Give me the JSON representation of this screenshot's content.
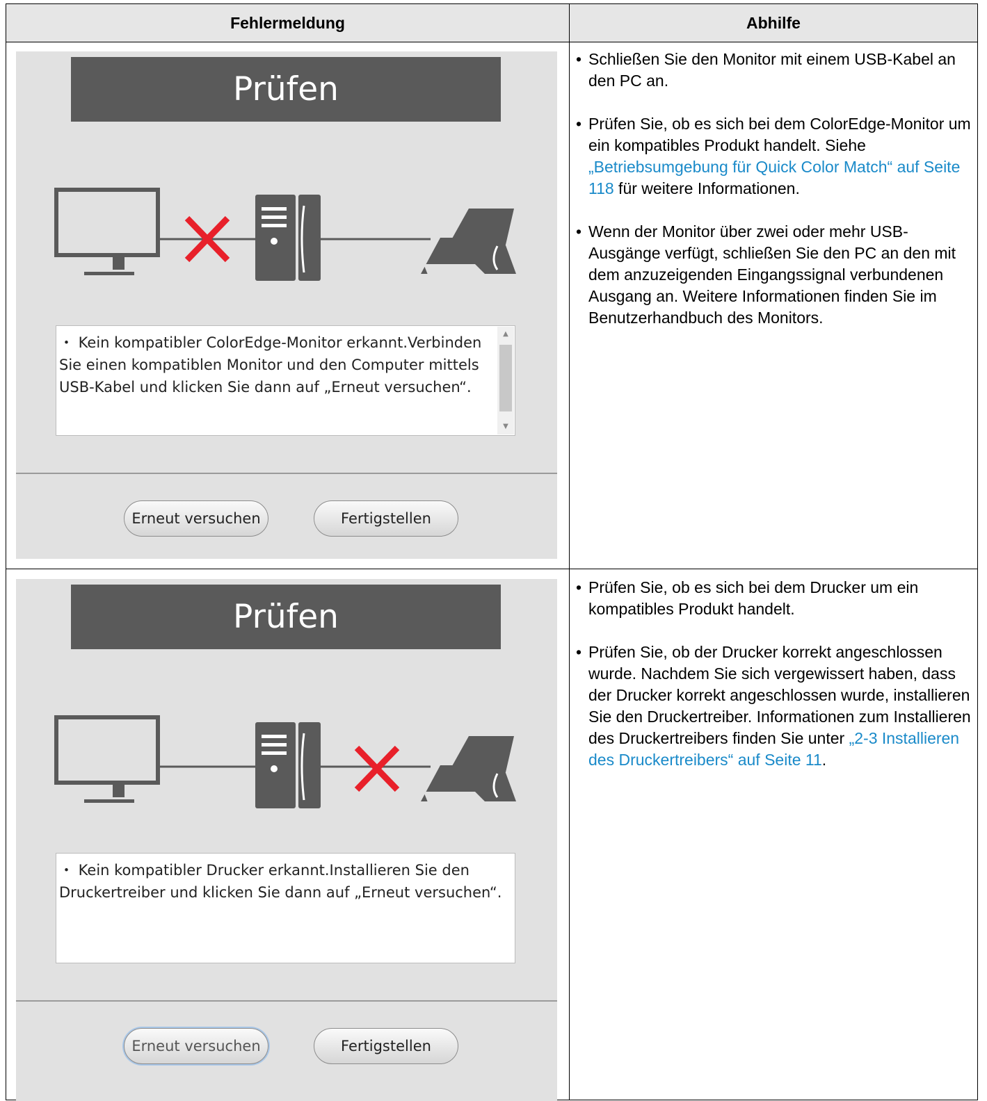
{
  "table": {
    "headers": [
      "Fehlermeldung",
      "Abhilfe"
    ]
  },
  "rows": [
    {
      "dialog": {
        "title": "Prüfen",
        "error_position": "monitor-pc",
        "message": "・ Kein kompatibler ColorEdge-Monitor erkannt.Verbinden Sie einen kompatiblen Monitor und den Computer mittels USB-Kabel und klicken Sie dann auf „Erneut versuchen“.",
        "retry_label": "Erneut versuchen",
        "finish_label": "Fertigstellen"
      },
      "remedy": {
        "item1": "Schließen Sie den Monitor mit einem USB-Kabel an den PC an.",
        "item2_pre": "Prüfen Sie, ob es sich bei dem ColorEdge-Monitor um ein kompatibles Produkt handelt. Siehe ",
        "item2_link": "„Betriebsumgebung für Quick Color Match“ auf Seite 118",
        "item2_post": " für weitere Informationen.",
        "item3": "Wenn der Monitor über zwei oder mehr USB-Ausgänge verfügt, schließen Sie den PC an den mit dem anzuzeigenden Eingangssignal verbundenen Ausgang an. Weitere Informationen finden Sie im Benutzerhandbuch des Monitors."
      }
    },
    {
      "dialog": {
        "title": "Prüfen",
        "error_position": "pc-printer",
        "message": "・ Kein kompatibler Drucker erkannt.Installieren Sie den Druckertreiber und klicken Sie dann auf „Erneut versuchen“.",
        "retry_label": "Erneut versuchen",
        "finish_label": "Fertigstellen"
      },
      "remedy": {
        "item1": "Prüfen Sie, ob es sich bei dem Drucker um ein kompatibles Produkt handelt.",
        "item2_pre": "Prüfen Sie, ob der Drucker korrekt angeschlossen wurde. Nachdem Sie sich vergewissert haben, dass der Drucker korrekt angeschlossen wurde, installieren Sie den Druckertreiber. Informationen zum Installieren des Druckertreibers finden Sie unter ",
        "item2_link": "„2-3 Installieren des Druckertreibers“ auf Seite 11",
        "item2_post": "."
      }
    }
  ],
  "colors": {
    "link": "#1a8ac9",
    "error_cross": "#e8202a",
    "device_gray": "#5a5a5a",
    "dialog_bg": "#e1e1e1"
  }
}
